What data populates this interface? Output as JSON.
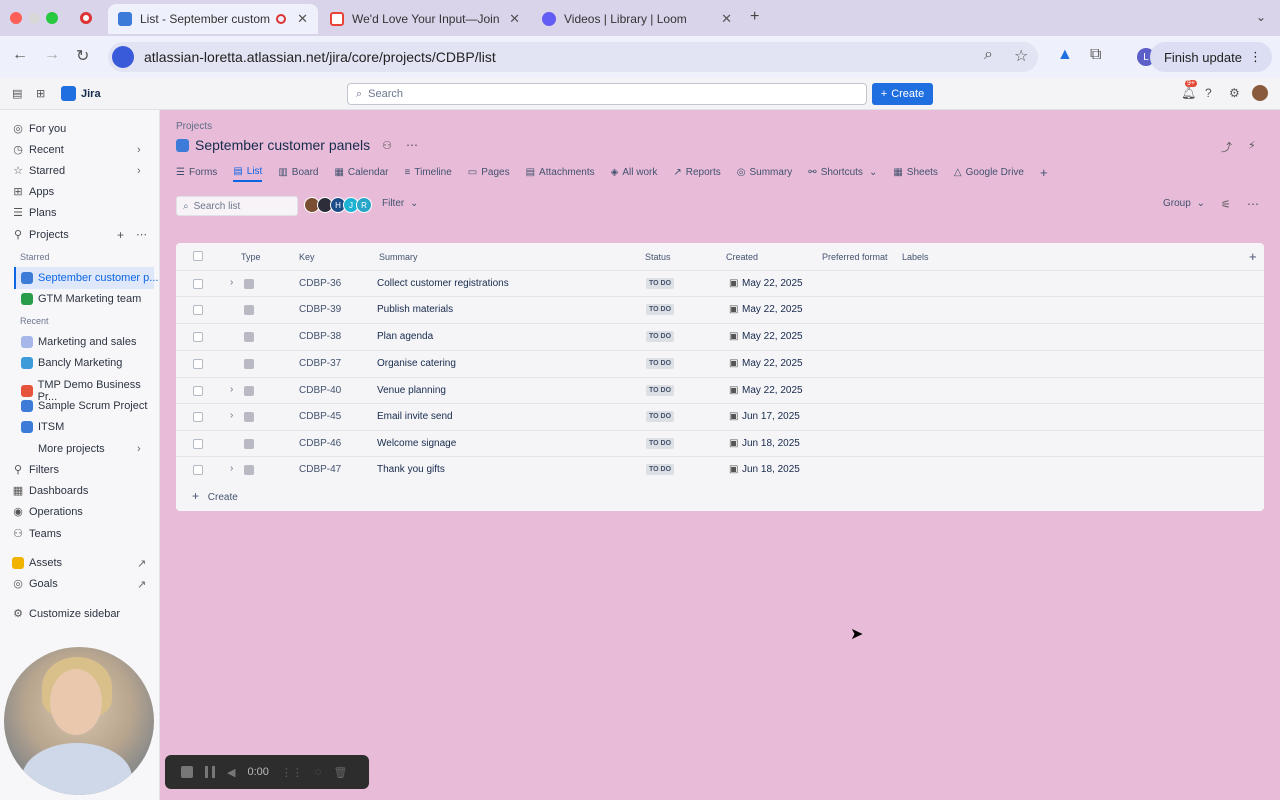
{
  "browser": {
    "tabs": [
      {
        "title": "List - September custome",
        "active": true,
        "favicon_color": "#3d7bd9"
      },
      {
        "title": "We'd Love Your Input—Join O",
        "active": false,
        "favicon_color": "#ea4335"
      },
      {
        "title": "Videos | Library | Loom",
        "active": false,
        "favicon_color": "#625df5"
      }
    ],
    "new_tab": "+",
    "url": "atlassian-loretta.atlassian.net/jira/core/projects/CDBP/list",
    "finish_update": "Finish update",
    "profile_initial": "L"
  },
  "app": {
    "name": "Jira",
    "search_placeholder": "Search",
    "create_label": "Create",
    "notification_badge": "9+"
  },
  "sidebar": {
    "items": [
      {
        "label": "For you",
        "icon": "user-icon"
      },
      {
        "label": "Recent",
        "icon": "clock-icon"
      },
      {
        "label": "Starred",
        "icon": "star-icon"
      },
      {
        "label": "Apps",
        "icon": "apps-icon"
      },
      {
        "label": "Plans",
        "icon": "plans-icon"
      },
      {
        "label": "Projects",
        "icon": "projects-icon"
      }
    ],
    "starred_heading": "Starred",
    "starred": [
      {
        "label": "September customer p...",
        "color": "#3d7bd9"
      },
      {
        "label": "GTM Marketing team",
        "color": "#2a9d4a"
      }
    ],
    "recent_heading": "Recent",
    "recent": [
      {
        "label": "Marketing and sales",
        "color": "#a7b6e8"
      },
      {
        "label": "Bancly Marketing",
        "color": "#3d9bd9"
      },
      {
        "label": "TMP Demo Business Pr...",
        "color": "#e5533d"
      },
      {
        "label": "Sample Scrum Project",
        "color": "#3d7bd9"
      },
      {
        "label": "ITSM",
        "color": "#3d7bd9"
      },
      {
        "label": "More projects",
        "color": "#f7f7f9"
      }
    ],
    "bottom": [
      {
        "label": "Filters",
        "icon": "filter-icon"
      },
      {
        "label": "Dashboards",
        "icon": "dashboard-icon"
      },
      {
        "label": "Operations",
        "icon": "operations-icon"
      },
      {
        "label": "Teams",
        "icon": "teams-icon"
      },
      {
        "label": "Assets",
        "icon": "assets-icon"
      },
      {
        "label": "Goals",
        "icon": "goals-icon"
      },
      {
        "label": "Customize sidebar",
        "icon": "settings-icon"
      }
    ]
  },
  "project": {
    "breadcrumb": "Projects",
    "title": "September customer panels",
    "tabs": [
      "Forms",
      "List",
      "Board",
      "Calendar",
      "Timeline",
      "Pages",
      "Attachments",
      "All work",
      "Reports",
      "Summary",
      "Shortcuts",
      "Sheets",
      "Google Drive"
    ],
    "active_tab": "List"
  },
  "toolbar": {
    "search_placeholder": "Search list",
    "filter_label": "Filter",
    "group_label": "Group",
    "avatar_initials": [
      "",
      "",
      "H",
      "J",
      "R"
    ]
  },
  "table": {
    "columns": [
      "Type",
      "Key",
      "Summary",
      "Status",
      "Created",
      "Preferred format",
      "Labels"
    ],
    "rows": [
      {
        "key": "CDBP-36",
        "summary": "Collect customer registrations",
        "status": "TO DO",
        "created": "May 22, 2025",
        "expandable": true
      },
      {
        "key": "CDBP-39",
        "summary": "Publish materials",
        "status": "TO DO",
        "created": "May 22, 2025",
        "expandable": false
      },
      {
        "key": "CDBP-38",
        "summary": "Plan agenda",
        "status": "TO DO",
        "created": "May 22, 2025",
        "expandable": false
      },
      {
        "key": "CDBP-37",
        "summary": "Organise catering",
        "status": "TO DO",
        "created": "May 22, 2025",
        "expandable": false
      },
      {
        "key": "CDBP-40",
        "summary": "Venue planning",
        "status": "TO DO",
        "created": "May 22, 2025",
        "expandable": true
      },
      {
        "key": "CDBP-45",
        "summary": "Email invite send",
        "status": "TO DO",
        "created": "Jun 17, 2025",
        "expandable": true
      },
      {
        "key": "CDBP-46",
        "summary": "Welcome signage",
        "status": "TO DO",
        "created": "Jun 18, 2025",
        "expandable": false
      },
      {
        "key": "CDBP-47",
        "summary": "Thank you gifts",
        "status": "TO DO",
        "created": "Jun 18, 2025",
        "expandable": true
      }
    ],
    "create_label": "Create"
  },
  "recorder": {
    "time": "0:00"
  }
}
